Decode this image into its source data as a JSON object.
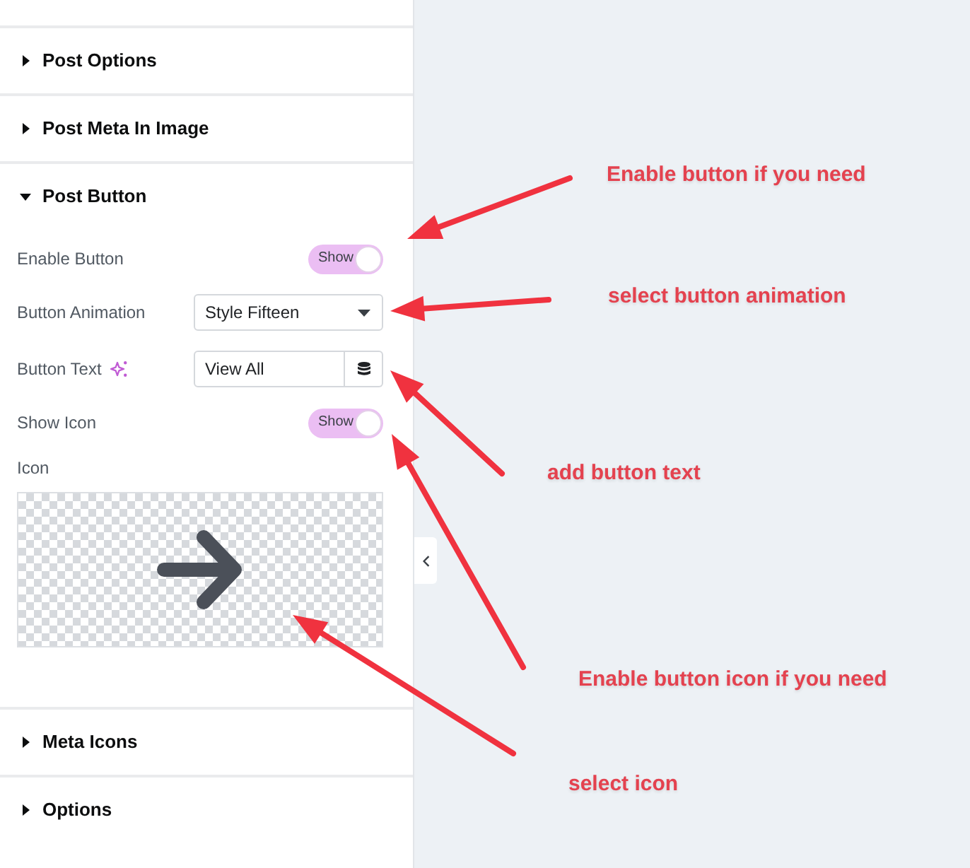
{
  "panel": {
    "sections": [
      {
        "title": "Post Options",
        "expanded": false
      },
      {
        "title": "Post Meta In Image",
        "expanded": false
      },
      {
        "title": "Post Button",
        "expanded": true,
        "controls": [
          {
            "kind": "switch",
            "label": "Enable Button",
            "on": true,
            "switch_text": "Show"
          },
          {
            "kind": "select",
            "label": "Button Animation",
            "value": "Style Fifteen"
          },
          {
            "kind": "text",
            "label": "Button Text",
            "value": "View All"
          },
          {
            "kind": "switch",
            "label": "Show Icon",
            "on": true,
            "switch_text": "Show"
          },
          {
            "kind": "icon",
            "label": "Icon"
          }
        ]
      },
      {
        "title": "Meta Icons",
        "expanded": false
      },
      {
        "title": "Options",
        "expanded": false
      }
    ]
  },
  "annotations": [
    {
      "text": "Enable button if you need"
    },
    {
      "text": "select button animation"
    },
    {
      "text": "add button text"
    },
    {
      "text": "Enable button icon if you need"
    },
    {
      "text": "select icon"
    }
  ]
}
